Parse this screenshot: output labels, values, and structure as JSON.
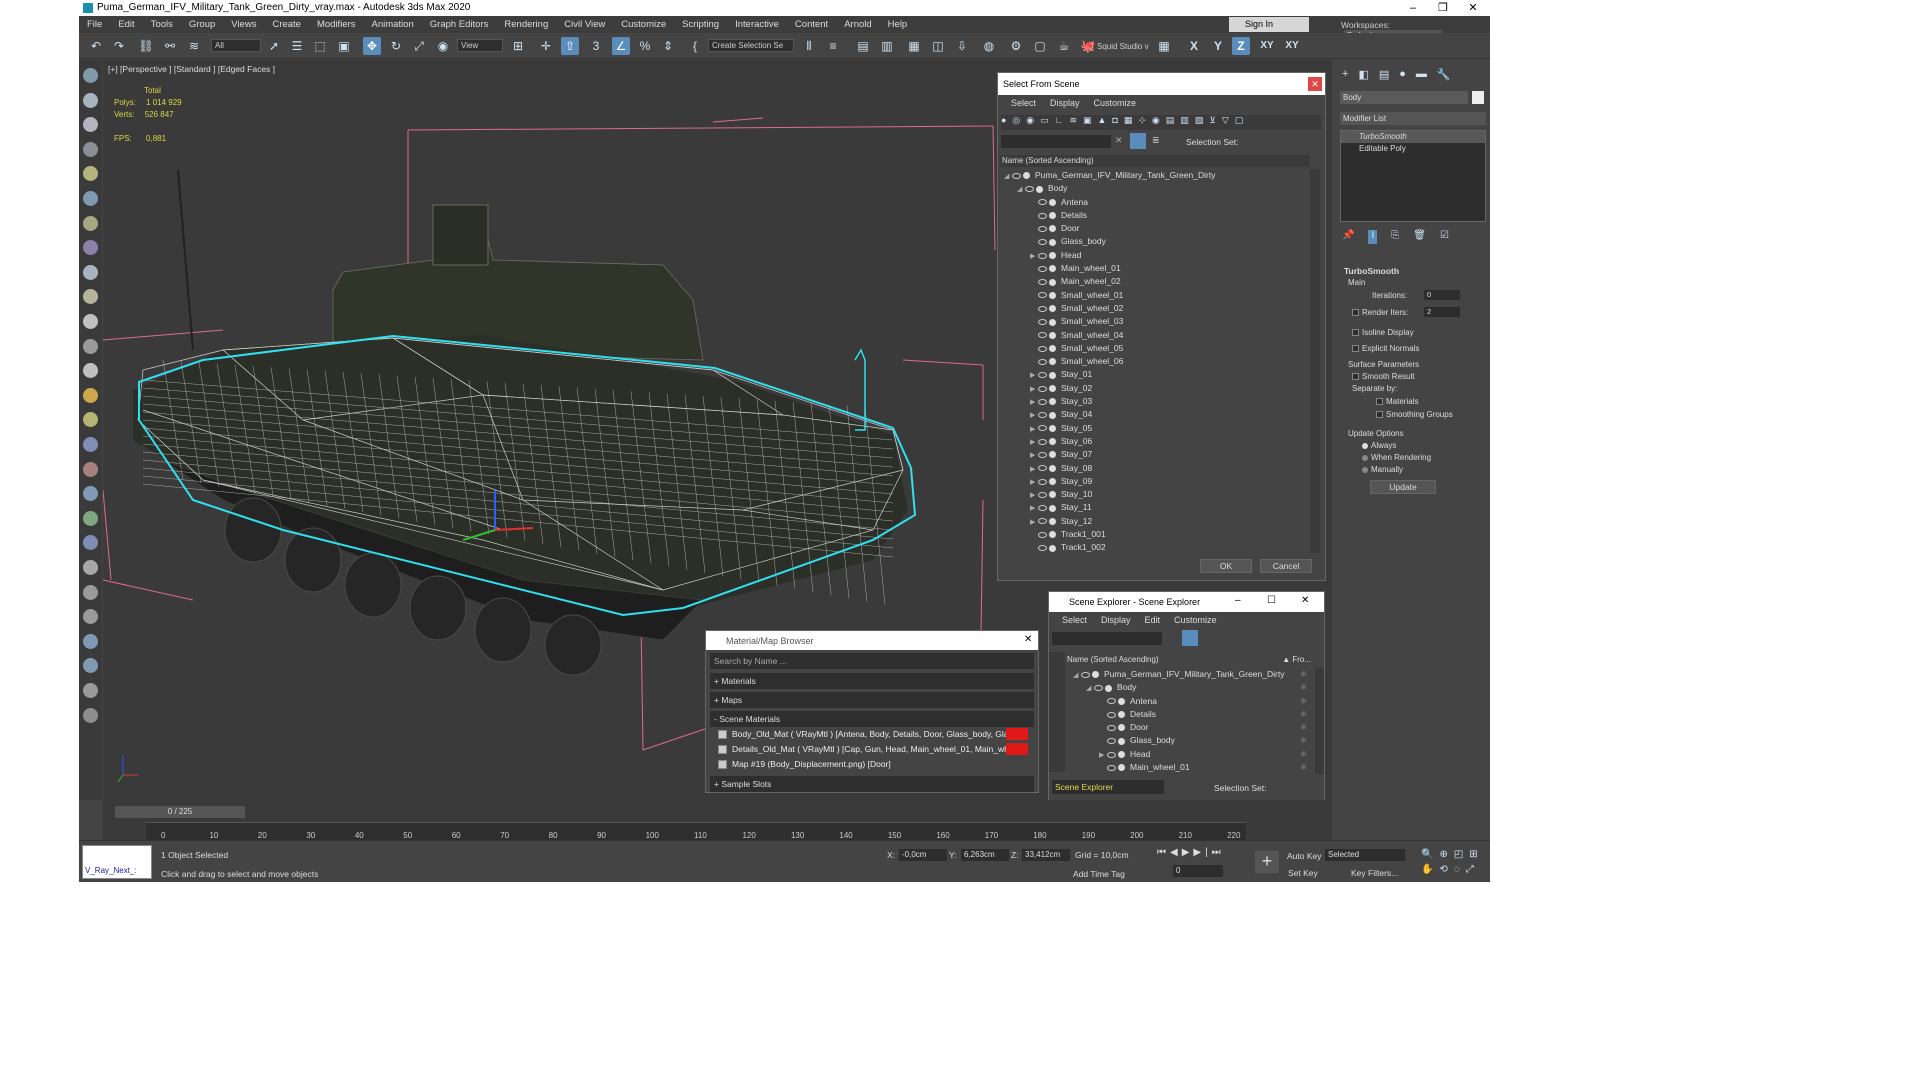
{
  "title": "Puma_German_IFV_Military_Tank_Green_Dirty_vray.max - Autodesk 3ds Max 2020",
  "menu": [
    "File",
    "Edit",
    "Tools",
    "Group",
    "Views",
    "Create",
    "Modifiers",
    "Animation",
    "Graph Editors",
    "Rendering",
    "Civil View",
    "Customize",
    "Scripting",
    "Interactive",
    "Content",
    "Arnold",
    "Help"
  ],
  "signin": "Sign In",
  "workspace_label": "Workspaces:",
  "workspace_value": "Default",
  "toolbar": {
    "filter": "All",
    "view": "View",
    "selset": "Create Selection Se",
    "squid": "Squid Studio v",
    "axes": [
      "X",
      "Y",
      "Z",
      "XY",
      "XY"
    ]
  },
  "viewport": {
    "label": "[+] [Perspective ] [Standard ] [Edged Faces ]",
    "total": "Total",
    "polys_label": "Polys:",
    "polys": "1 014 929",
    "verts_label": "Verts:",
    "verts": "526 847",
    "fps_label": "FPS:",
    "fps": "0,881"
  },
  "sfs": {
    "title": "Select From Scene",
    "menu": [
      "Select",
      "Display",
      "Customize"
    ],
    "selection_set": "Selection Set:",
    "column": "Name (Sorted Ascending)",
    "ok": "OK",
    "cancel": "Cancel",
    "rows": [
      {
        "n": "Puma_German_IFV_Military_Tank_Green_Dirty",
        "lvl": 0,
        "exp": "open"
      },
      {
        "n": "Body",
        "lvl": 1,
        "exp": "open"
      },
      {
        "n": "Antena",
        "lvl": 2,
        "exp": ""
      },
      {
        "n": "Details",
        "lvl": 2,
        "exp": ""
      },
      {
        "n": "Door",
        "lvl": 2,
        "exp": ""
      },
      {
        "n": "Glass_body",
        "lvl": 2,
        "exp": ""
      },
      {
        "n": "Head",
        "lvl": 2,
        "exp": "closed"
      },
      {
        "n": "Main_wheel_01",
        "lvl": 2,
        "exp": ""
      },
      {
        "n": "Main_wheel_02",
        "lvl": 2,
        "exp": ""
      },
      {
        "n": "Small_wheel_01",
        "lvl": 2,
        "exp": ""
      },
      {
        "n": "Small_wheel_02",
        "lvl": 2,
        "exp": ""
      },
      {
        "n": "Small_wheel_03",
        "lvl": 2,
        "exp": ""
      },
      {
        "n": "Small_wheel_04",
        "lvl": 2,
        "exp": ""
      },
      {
        "n": "Small_wheel_05",
        "lvl": 2,
        "exp": ""
      },
      {
        "n": "Small_wheel_06",
        "lvl": 2,
        "exp": ""
      },
      {
        "n": "Stay_01",
        "lvl": 2,
        "exp": "closed"
      },
      {
        "n": "Stay_02",
        "lvl": 2,
        "exp": "closed"
      },
      {
        "n": "Stay_03",
        "lvl": 2,
        "exp": "closed"
      },
      {
        "n": "Stay_04",
        "lvl": 2,
        "exp": "closed"
      },
      {
        "n": "Stay_05",
        "lvl": 2,
        "exp": "closed"
      },
      {
        "n": "Stay_06",
        "lvl": 2,
        "exp": "closed"
      },
      {
        "n": "Stay_07",
        "lvl": 2,
        "exp": "closed"
      },
      {
        "n": "Stay_08",
        "lvl": 2,
        "exp": "closed"
      },
      {
        "n": "Stay_09",
        "lvl": 2,
        "exp": "closed"
      },
      {
        "n": "Stay_10",
        "lvl": 2,
        "exp": "closed"
      },
      {
        "n": "Stay_11",
        "lvl": 2,
        "exp": "closed"
      },
      {
        "n": "Stay_12",
        "lvl": 2,
        "exp": "closed"
      },
      {
        "n": "Track1_001",
        "lvl": 2,
        "exp": ""
      },
      {
        "n": "Track1_002",
        "lvl": 2,
        "exp": ""
      }
    ]
  },
  "se": {
    "title": "Scene Explorer - Scene Explorer",
    "menu": [
      "Select",
      "Display",
      "Edit",
      "Customize"
    ],
    "column": "Name (Sorted Ascending)",
    "column2": "▲ Fro...",
    "footer": "Scene Explorer",
    "selection_set": "Selection Set:",
    "rows": [
      {
        "n": "Puma_German_IFV_Military_Tank_Green_Dirty",
        "lvl": 0,
        "exp": "open"
      },
      {
        "n": "Body",
        "lvl": 1,
        "exp": "open"
      },
      {
        "n": "Antena",
        "lvl": 2,
        "exp": ""
      },
      {
        "n": "Details",
        "lvl": 2,
        "exp": ""
      },
      {
        "n": "Door",
        "lvl": 2,
        "exp": ""
      },
      {
        "n": "Glass_body",
        "lvl": 2,
        "exp": ""
      },
      {
        "n": "Head",
        "lvl": 2,
        "exp": "closed"
      },
      {
        "n": "Main_wheel_01",
        "lvl": 2,
        "exp": ""
      }
    ]
  },
  "mmb": {
    "title": "Material/Map Browser",
    "search": "Search by Name ...",
    "materials": "+ Materials",
    "maps": "+ Maps",
    "scene_materials": "- Scene Materials",
    "sample_slots": "+ Sample Slots",
    "items": [
      "Body_Old_Mat ( VRayMtl ) [Antena, Body, Details, Door, Glass_body, Glass...",
      "Details_Old_Mat ( VRayMtl ) [Cap, Gun, Head, Main_wheel_01, Main_wheel...",
      "Map #19 (Body_Displacement.png) [Door]"
    ]
  },
  "right": {
    "name": "Body",
    "modifier_list": "Modifier List",
    "stack": [
      "TurboSmooth",
      "Editable Poly"
    ],
    "rollout": "TurboSmooth",
    "main": "Main",
    "iterations_label": "Iterations:",
    "iterations": "0",
    "render_iters_label": "Render Iters:",
    "render_iters": "2",
    "isoline": "Isoline Display",
    "explicit": "Explicit Normals",
    "surface": "Surface Parameters",
    "smooth_result": "Smooth Result",
    "separate_by": "Separate by:",
    "materials": "Materials",
    "smoothing_groups": "Smoothing Groups",
    "update_options": "Update Options",
    "always": "Always",
    "when_rendering": "When Rendering",
    "manually": "Manually",
    "update": "Update"
  },
  "timeline": {
    "frame": "0 / 225",
    "ticks": [
      "0",
      "10",
      "20",
      "30",
      "40",
      "50",
      "60",
      "70",
      "80",
      "90",
      "100",
      "110",
      "120",
      "130",
      "140",
      "150",
      "160",
      "170",
      "180",
      "190",
      "200",
      "210",
      "220"
    ]
  },
  "status": {
    "script": "V_Ray_Next_:",
    "selected": "1 Object Selected",
    "hint": "Click and drag to select and move objects",
    "x_label": "X:",
    "x": "-0,0cm",
    "y_label": "Y:",
    "y": "6,263cm",
    "z_label": "Z:",
    "z": "33,412cm",
    "grid": "Grid = 10,0cm",
    "autokey": "Auto Key",
    "setkey": "Set Key",
    "selected_combo": "Selected",
    "keyfilters": "Key Filters...",
    "addtime": "Add Time Tag",
    "frame": "0"
  }
}
